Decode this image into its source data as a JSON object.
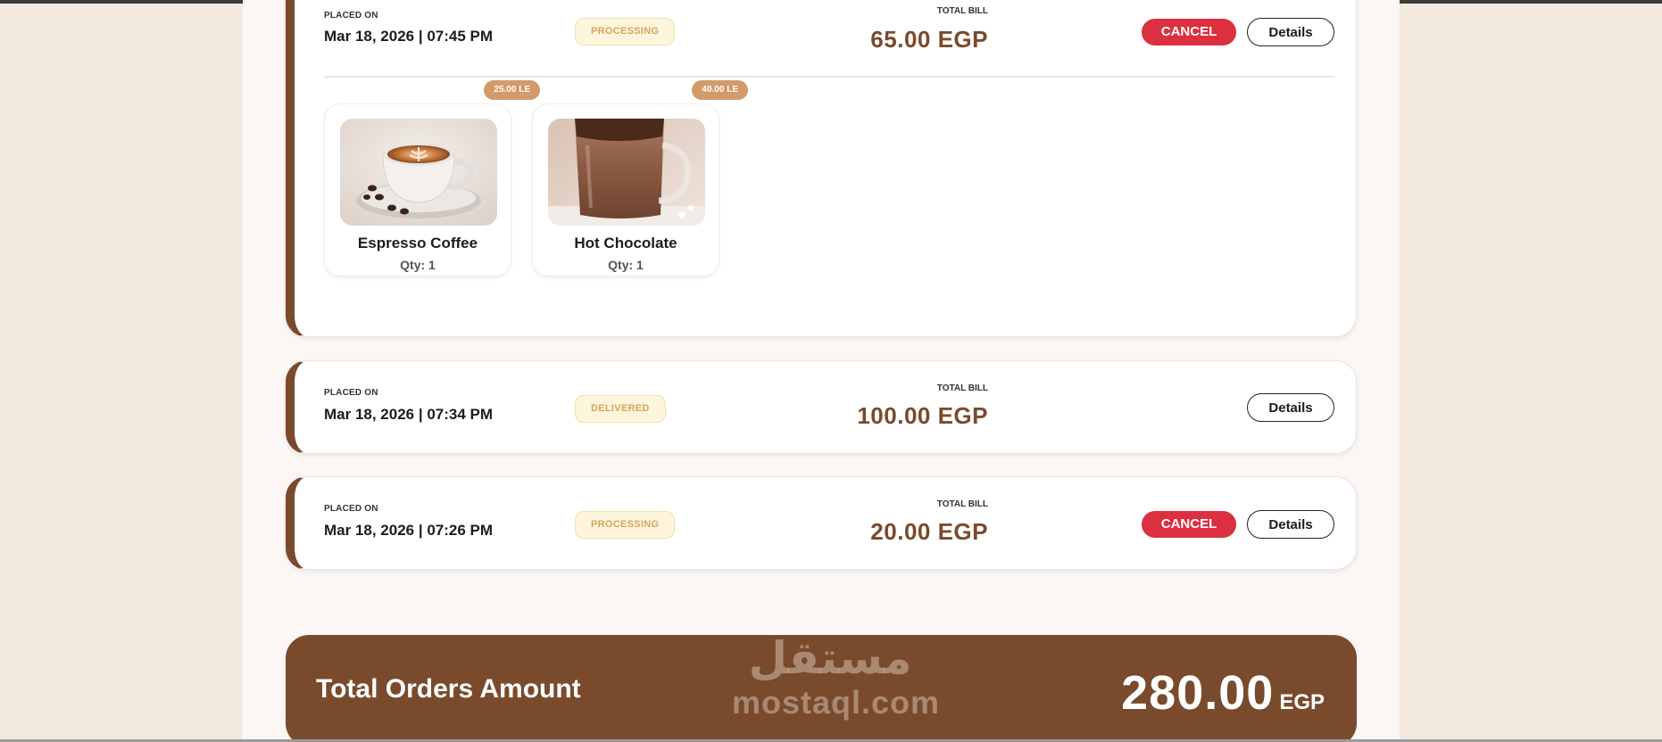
{
  "orders": [
    {
      "placed_label": "PLACED ON",
      "date": "Mar 18, 2026 | 07:45 PM",
      "status": "PROCESSING",
      "bill_label": "TOTAL BILL",
      "bill": "65.00 EGP",
      "cancel_label": "CANCEL",
      "details_label": "Details",
      "items": [
        {
          "name": "Espresso Coffee",
          "qty": "Qty: 1",
          "price": "25.00 LE",
          "image_icon": "espresso-cup-image"
        },
        {
          "name": "Hot Chocolate",
          "qty": "Qty: 1",
          "price": "40.00 LE",
          "image_icon": "hot-chocolate-glass-image"
        }
      ]
    },
    {
      "placed_label": "PLACED ON",
      "date": "Mar 18, 2026 | 07:34 PM",
      "status": "DELIVERED",
      "bill_label": "TOTAL BILL",
      "bill": "100.00 EGP",
      "details_label": "Details"
    },
    {
      "placed_label": "PLACED ON",
      "date": "Mar 18, 2026 | 07:26 PM",
      "status": "PROCESSING",
      "bill_label": "TOTAL BILL",
      "bill": "20.00 EGP",
      "cancel_label": "CANCEL",
      "details_label": "Details"
    }
  ],
  "total": {
    "label": "Total Orders Amount",
    "amount": "280.00",
    "currency": "EGP"
  },
  "watermark": {
    "arabic": "مستقل",
    "latin": "mostaql.com"
  },
  "colors": {
    "accent_brown": "#7a4a2c",
    "cancel_red": "#dc2f3f",
    "status_text": "#d8a35e",
    "page_bg": "#f3e9df"
  }
}
